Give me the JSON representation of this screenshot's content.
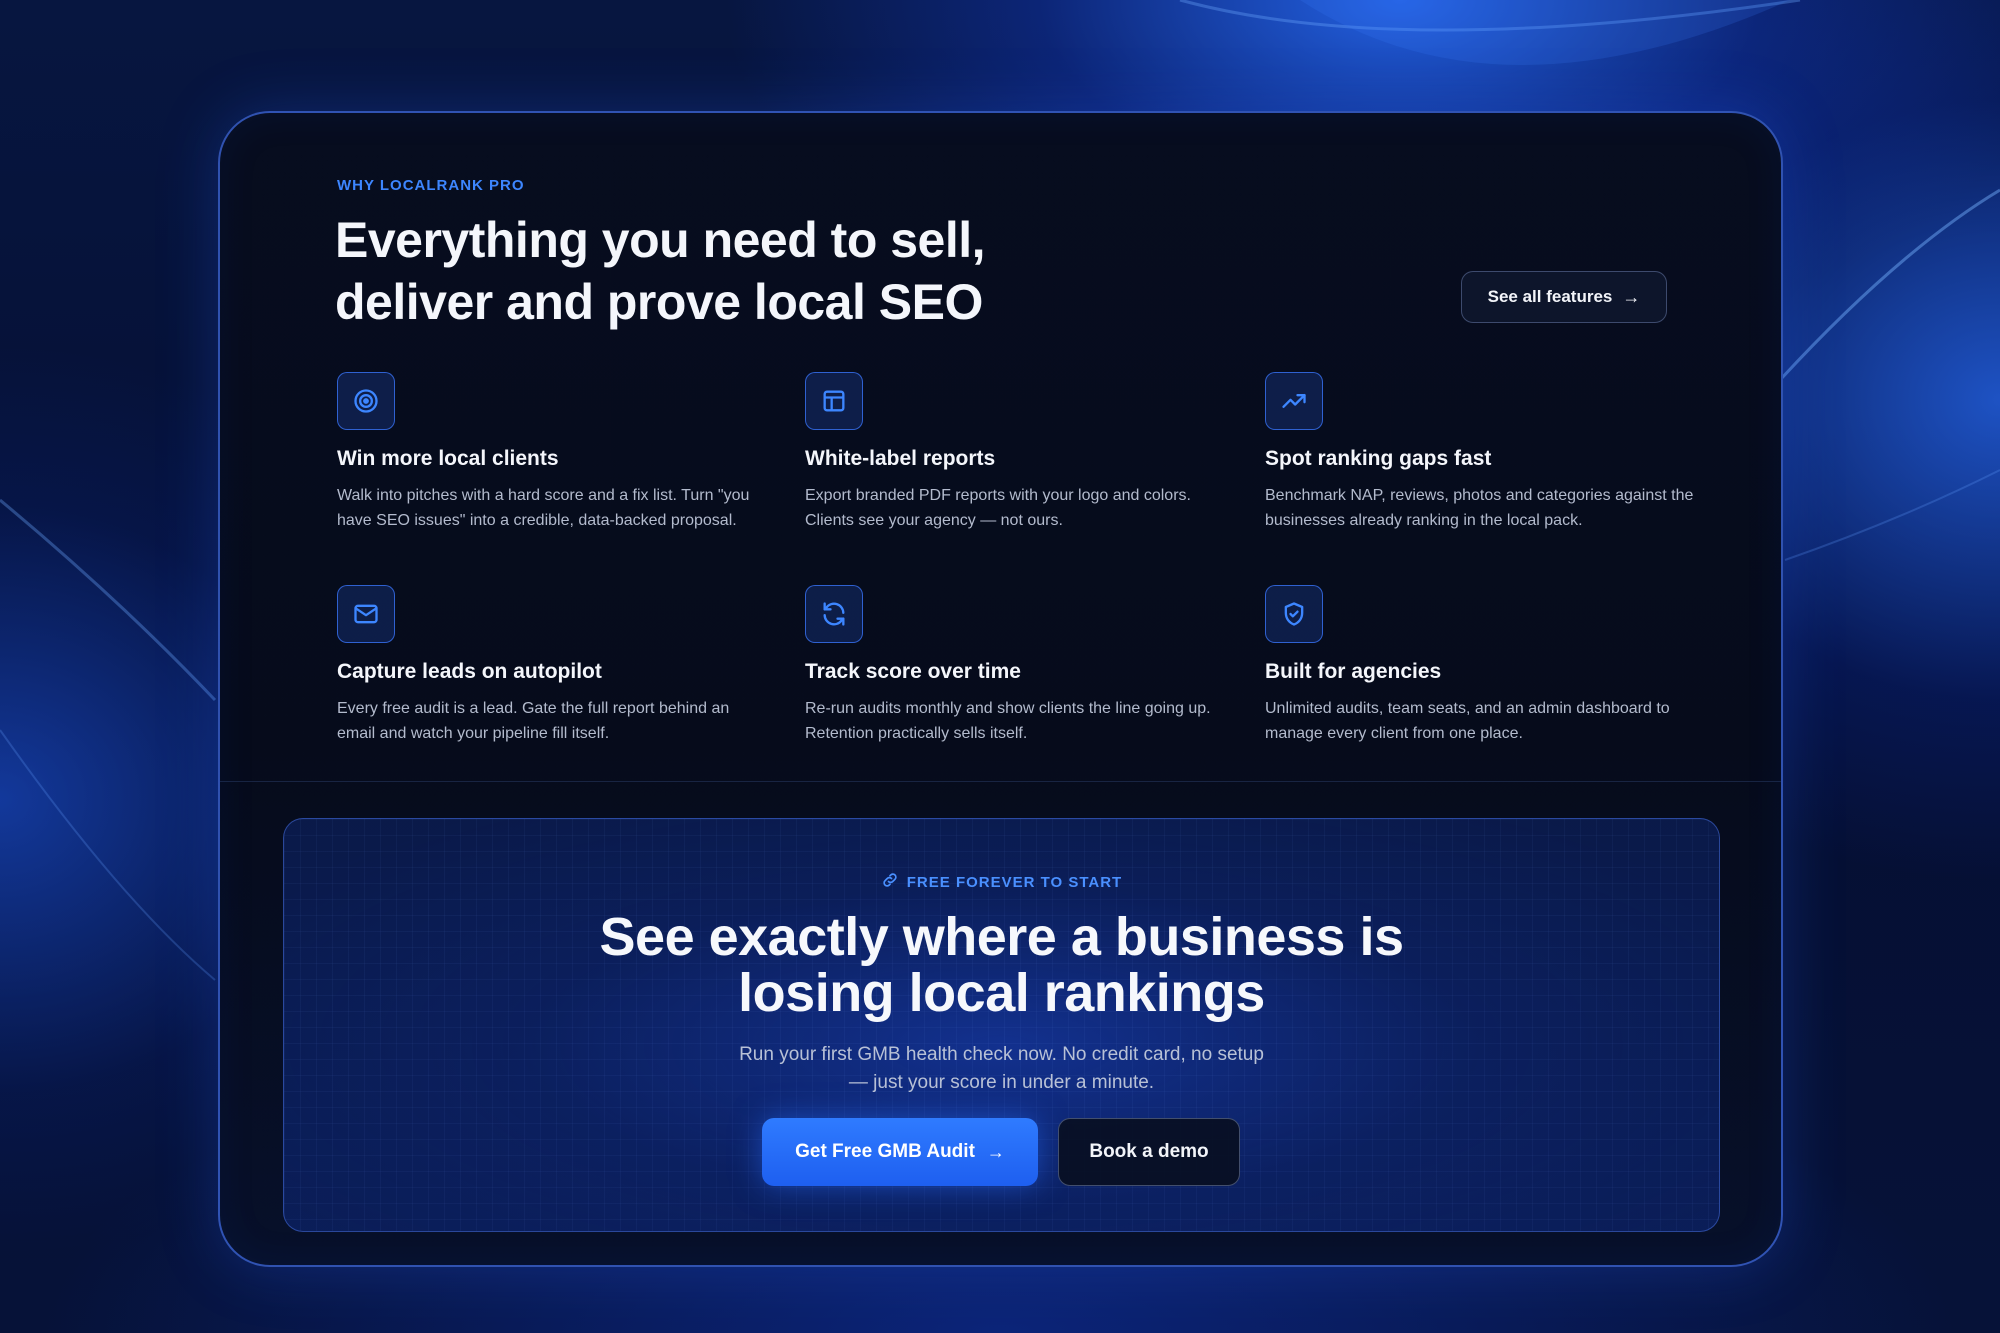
{
  "colors": {
    "accent": "#3d86ff",
    "primary_button": "#2a6fff",
    "card_background": "#070d1f",
    "background": "#041033"
  },
  "features_section": {
    "eyebrow": "WHY LOCALRANK PRO",
    "headline_line1": "Everything you need to sell,",
    "headline_line2": "deliver and prove local SEO",
    "see_all_label": "See all features",
    "see_all_icon": "arrow-right-icon",
    "items": [
      {
        "icon": "target-icon",
        "title": "Win more local clients",
        "description": "Walk into pitches with a hard score and a fix list. Turn \"you have SEO issues\" into a credible, data-backed proposal."
      },
      {
        "icon": "layout-icon",
        "title": "White-label reports",
        "description": "Export branded PDF reports with your logo and colors. Clients see your agency — not ours."
      },
      {
        "icon": "trending-up-icon",
        "title": "Spot ranking gaps fast",
        "description": "Benchmark NAP, reviews, photos and categories against the businesses already ranking in the local pack."
      },
      {
        "icon": "mail-icon",
        "title": "Capture leads on autopilot",
        "description": "Every free audit is a lead. Gate the full report behind an email and watch your pipeline fill itself."
      },
      {
        "icon": "refresh-icon",
        "title": "Track score over time",
        "description": "Re-run audits monthly and show clients the line going up. Retention practically sells itself."
      },
      {
        "icon": "shield-check-icon",
        "title": "Built for agencies",
        "description": "Unlimited audits, team seats, and an admin dashboard to manage every client from one place."
      }
    ]
  },
  "cta_section": {
    "eyebrow_icon": "link-icon",
    "eyebrow": "FREE FOREVER TO START",
    "title_line1": "See exactly where a business is",
    "title_line2": "losing local rankings",
    "subtitle_line1": "Run your first GMB health check now. No credit card, no setup",
    "subtitle_line2": "— just your score in under a minute.",
    "primary_button_label": "Get Free GMB Audit",
    "primary_button_icon": "arrow-right-icon",
    "secondary_button_label": "Book a demo"
  }
}
